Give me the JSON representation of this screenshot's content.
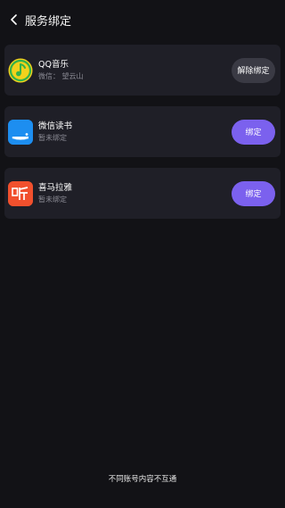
{
  "header": {
    "title": "服务绑定"
  },
  "services": [
    {
      "name": "QQ音乐",
      "status": "微信： 望云山",
      "action": "解除绑定",
      "icon": "qq-music-icon"
    },
    {
      "name": "微信读书",
      "status": "暂未绑定",
      "action": "绑定",
      "icon": "weread-icon"
    },
    {
      "name": "喜马拉雅",
      "status": "暂未绑定",
      "action": "绑定",
      "icon": "ximalaya-icon"
    }
  ],
  "footer": {
    "note": "不同账号内容不互通"
  },
  "colors": {
    "background": "#121216",
    "card": "#1f1f27",
    "accent": "#7b61ee",
    "unbind": "#3a3a44"
  }
}
